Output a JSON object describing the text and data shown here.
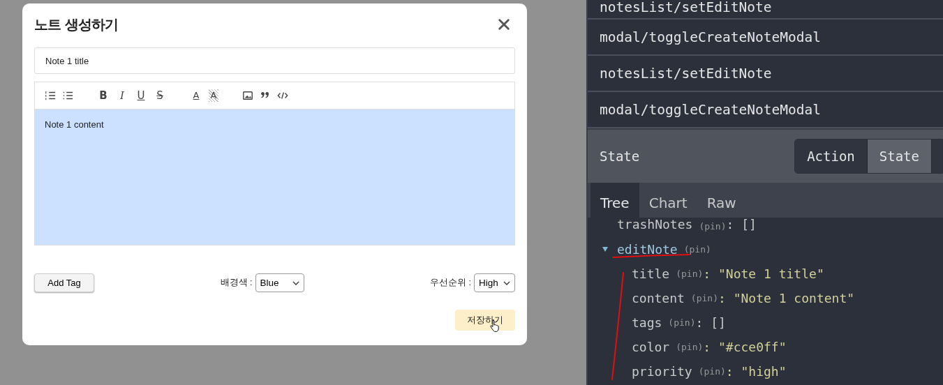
{
  "modal": {
    "title": "노트 생성하기",
    "title_field": {
      "value": "Note 1 title"
    },
    "toolbar": [
      [
        {
          "kind": "ordered-list"
        },
        {
          "kind": "bullet-list"
        }
      ],
      [
        {
          "kind": "bold",
          "label": "B"
        },
        {
          "kind": "italic",
          "label": "I"
        },
        {
          "kind": "underline",
          "label": "U"
        },
        {
          "kind": "strike",
          "label": "S"
        }
      ],
      [
        {
          "kind": "font-color",
          "label": "A"
        },
        {
          "kind": "background",
          "label": "A"
        }
      ],
      [
        {
          "kind": "image"
        },
        {
          "kind": "quote"
        },
        {
          "kind": "code"
        }
      ]
    ],
    "editor": {
      "content": "Note 1 content",
      "color": "#cce0ff"
    },
    "add_tag_button": "Add Tag",
    "background_select": {
      "label": "배경색 :",
      "value": "Blue"
    },
    "priority_select": {
      "label": "우선순위 :",
      "value": "High"
    },
    "save_button": "저장하기"
  },
  "devtools": {
    "actions": [
      {
        "label": "notesList/setEditNote"
      },
      {
        "label": "modal/toggleCreateNoteModal"
      },
      {
        "label": "notesList/setEditNote"
      },
      {
        "label": "modal/toggleCreateNoteModal"
      }
    ],
    "header": {
      "title": "State",
      "modes": [
        {
          "label": "Action",
          "selected": false
        },
        {
          "label": "State",
          "selected": true
        }
      ]
    },
    "tabs": [
      {
        "label": "Tree",
        "selected": true
      },
      {
        "label": "Chart",
        "selected": false
      },
      {
        "label": "Raw",
        "selected": false
      }
    ],
    "tree": [
      {
        "key": "trashNotes",
        "pin": "(pin)",
        "value": ": []",
        "kind": "array"
      },
      {
        "key": "editNote",
        "pin": "(pin)",
        "expanded": true,
        "kind": "object",
        "children": [
          {
            "key": "title",
            "pin": "(pin)",
            "value": ": \"Note 1 title\"",
            "kind": "string"
          },
          {
            "key": "content",
            "pin": "(pin)",
            "value": ": \"Note 1 content\"",
            "kind": "string"
          },
          {
            "key": "tags",
            "pin": "(pin)",
            "value": ": []",
            "kind": "array"
          },
          {
            "key": "color",
            "pin": "(pin)",
            "value": ": \"#cce0ff\"",
            "kind": "string"
          },
          {
            "key": "priority",
            "pin": "(pin)",
            "value": ": \"high\"",
            "kind": "string"
          }
        ]
      }
    ]
  }
}
